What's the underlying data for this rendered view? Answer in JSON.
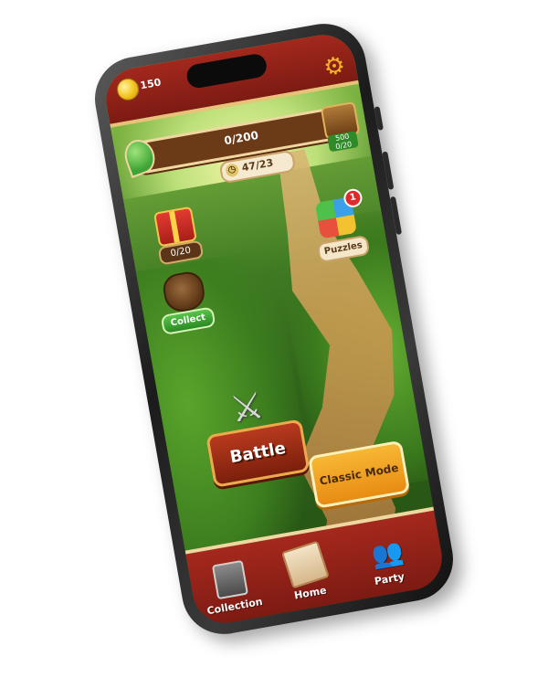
{
  "topbar": {
    "coins": "150",
    "settings_icon": "gear-icon"
  },
  "progress": {
    "value": 0,
    "max": 200,
    "label": "0/200",
    "chest_reward": "500\n0/20"
  },
  "counter": {
    "icon": "clock-icon",
    "value": "47/23"
  },
  "gift": {
    "count": "0/20"
  },
  "collect": {
    "label": "Collect"
  },
  "puzzles": {
    "label": "Puzzles",
    "badge": "1"
  },
  "modes": {
    "battle_label": "Battle",
    "classic_label": "Classic Mode"
  },
  "nav": {
    "collection": "Collection",
    "home": "Home",
    "party": "Party"
  }
}
